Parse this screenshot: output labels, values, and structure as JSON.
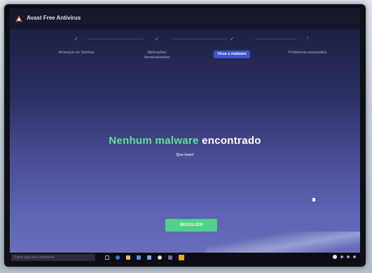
{
  "window": {
    "title": "Avast Free Antivirus",
    "right_items": [
      "",
      ""
    ]
  },
  "steps": [
    {
      "label": "Ameaças às Senhas",
      "mark": "✓",
      "state": "done"
    },
    {
      "label": "Aplicações desatualizadas",
      "mark": "✓",
      "state": "done"
    },
    {
      "label": "Vírus e malware",
      "mark": "✓",
      "state": "active"
    },
    {
      "label": "Problemas avançados",
      "mark": "!",
      "state": "alert"
    }
  ],
  "result": {
    "headline_part1": "Nenhum malware",
    "headline_part2": "encontrado",
    "sub_text": "Que bom!"
  },
  "actions": {
    "primary_label": "RESOLVER"
  },
  "taskbar": {
    "search_placeholder": "Digite aqui para pesquisar",
    "icons": [
      "task-view-icon",
      "edge-icon",
      "explorer-icon",
      "store-icon",
      "mail-icon",
      "chrome-icon",
      "media-icon",
      "avast-icon"
    ]
  },
  "colors": {
    "accent_green": "#5ee39a",
    "button_green": "#4fd18a",
    "active_step_blue": "#3f53c8",
    "alert_red": "#ff4d55"
  }
}
